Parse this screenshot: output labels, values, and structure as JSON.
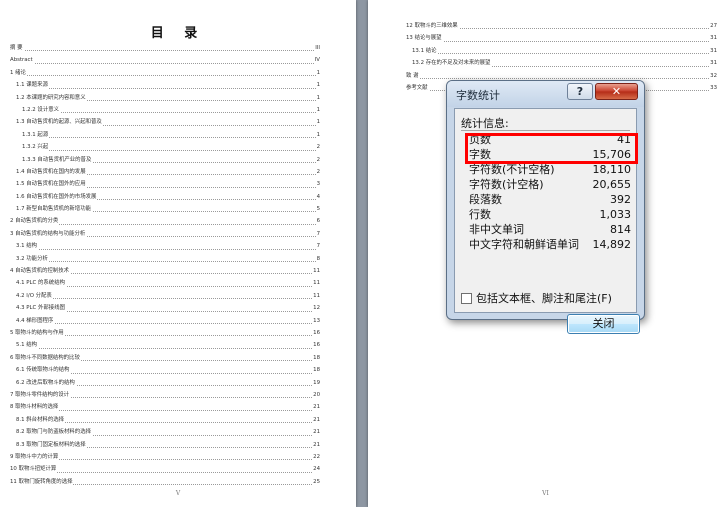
{
  "document": {
    "left_page": {
      "title": "目 录",
      "page_number": "V",
      "entries": [
        {
          "title": "摘 要",
          "page": "III",
          "level": 0
        },
        {
          "title": "Abstract",
          "page": "IV",
          "level": 0
        },
        {
          "title": "1 绪论",
          "page": "1",
          "level": 0
        },
        {
          "title": "1.1 课题来源",
          "page": "1",
          "level": 1
        },
        {
          "title": "1.2 本课题的研究内容和意义",
          "page": "1",
          "level": 1
        },
        {
          "title": "1.2.2 设计意义",
          "page": "1",
          "level": 2
        },
        {
          "title": "1.3 自动售货机的起源、兴起和普及",
          "page": "1",
          "level": 1
        },
        {
          "title": "1.3.1 起源",
          "page": "1",
          "level": 2
        },
        {
          "title": "1.3.2 兴起",
          "page": "2",
          "level": 2
        },
        {
          "title": "1.3.3 自动售货机产业的普及",
          "page": "2",
          "level": 2
        },
        {
          "title": "1.4 自动售货机在国内的发展",
          "page": "2",
          "level": 1
        },
        {
          "title": "1.5 自动售货机在国外的应用",
          "page": "3",
          "level": 1
        },
        {
          "title": "1.6 自动售货机在国外的市场发展",
          "page": "4",
          "level": 1
        },
        {
          "title": "1.7 新型自助售货机的新增功能",
          "page": "5",
          "level": 1
        },
        {
          "title": "2 自动售货机的分类",
          "page": "6",
          "level": 0
        },
        {
          "title": "3 自动售货机的结构与功能分析",
          "page": "7",
          "level": 0
        },
        {
          "title": "3.1 结构",
          "page": "7",
          "level": 1
        },
        {
          "title": "3.2 功能分析",
          "page": "8",
          "level": 1
        },
        {
          "title": "4 自动售货机的控制技术",
          "page": "11",
          "level": 0
        },
        {
          "title": "4.1 PLC 的系统结构",
          "page": "11",
          "level": 1
        },
        {
          "title": "4.2 I/O 分配表",
          "page": "11",
          "level": 1
        },
        {
          "title": "4.3 PLC 外部接线图",
          "page": "12",
          "level": 1
        },
        {
          "title": "4.4 梯形图程序",
          "page": "13",
          "level": 1
        },
        {
          "title": "5 取物斗的结构与作用",
          "page": "16",
          "level": 0
        },
        {
          "title": "5.1 结构",
          "page": "16",
          "level": 1
        },
        {
          "title": "6 取物斗不同数据结构的比较",
          "page": "18",
          "level": 0
        },
        {
          "title": "6.1 传统取物斗的结构",
          "page": "18",
          "level": 1
        },
        {
          "title": "6.2 改进后取物斗的结构",
          "page": "19",
          "level": 1
        },
        {
          "title": "7 取物斗零件结构的设计",
          "page": "20",
          "level": 0
        },
        {
          "title": "8 取物斗材料的选择",
          "page": "21",
          "level": 0
        },
        {
          "title": "8.1 斜台材料的选择",
          "page": "21",
          "level": 1
        },
        {
          "title": "8.2 取物门与防盗板材料的选择",
          "page": "21",
          "level": 1
        },
        {
          "title": "8.3 取物门固定板材料的选择",
          "page": "21",
          "level": 1
        },
        {
          "title": "9 取物斗中力的计算",
          "page": "22",
          "level": 0
        },
        {
          "title": "10 取物斗扭矩计算",
          "page": "24",
          "level": 0
        },
        {
          "title": "11 取物门旋转角度的选择",
          "page": "25",
          "level": 0
        }
      ]
    },
    "right_page": {
      "page_number": "VI",
      "entries": [
        {
          "title": "12 取物斗的三维效果",
          "page": "27",
          "level": 0
        },
        {
          "title": "13 结论与展望",
          "page": "31",
          "level": 0
        },
        {
          "title": "13.1 结论",
          "page": "31",
          "level": 1
        },
        {
          "title": "13.2 存在的不足及对未来的展望",
          "page": "31",
          "level": 1
        },
        {
          "title": "致 谢",
          "page": "32",
          "level": 0
        },
        {
          "title": "参考文献",
          "page": "33",
          "level": 0
        }
      ]
    }
  },
  "dialog": {
    "title": "字数统计",
    "help_label": "?",
    "close_label": "✕",
    "section_label": "统计信息:",
    "stats": [
      {
        "label": "页数",
        "value": "41",
        "highlighted": true
      },
      {
        "label": "字数",
        "value": "15,706",
        "highlighted": true
      },
      {
        "label": "字符数(不计空格)",
        "value": "18,110"
      },
      {
        "label": "字符数(计空格)",
        "value": "20,655"
      },
      {
        "label": "段落数",
        "value": "392"
      },
      {
        "label": "行数",
        "value": "1,033"
      },
      {
        "label": "非中文单词",
        "value": "814"
      },
      {
        "label": "中文字符和朝鲜语单词",
        "value": "14,892"
      }
    ],
    "checkbox_label": "包括文本框、脚注和尾注(F)",
    "checkbox_checked": false,
    "ok_label": "关闭"
  },
  "colors": {
    "highlight_box": "#ff0000",
    "workspace_background": "#8e97a3",
    "dialog_frame": "#c7d6e8",
    "close_button": "#c8402c"
  },
  "icons": [
    "help-icon",
    "close-icon",
    "checkbox"
  ]
}
